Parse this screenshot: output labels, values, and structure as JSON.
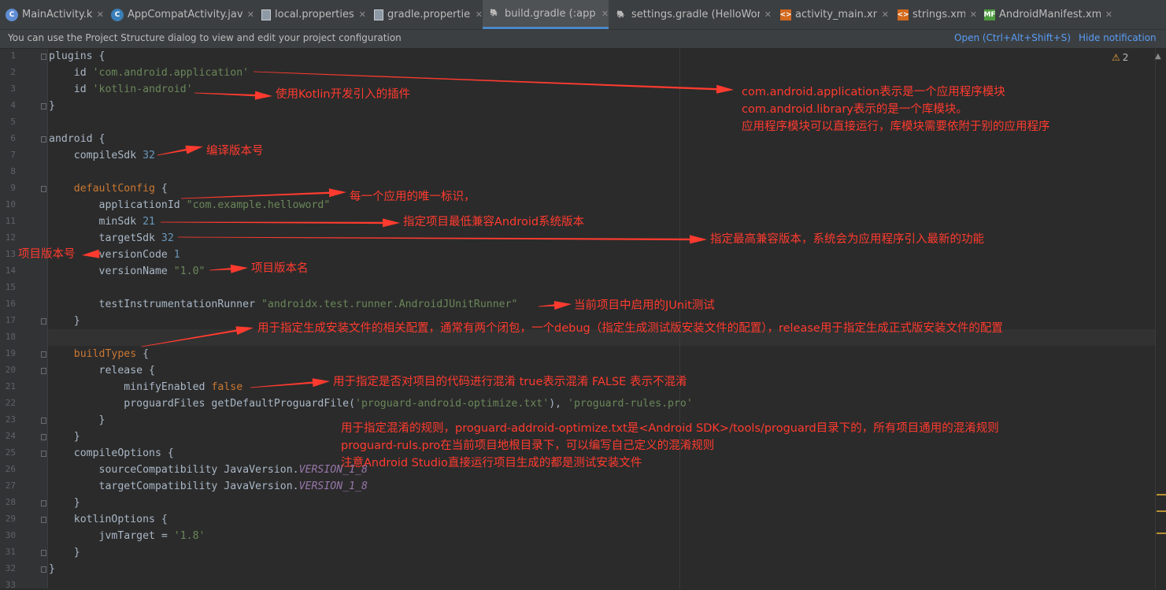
{
  "tabs": [
    {
      "label": "MainActivity.kt",
      "icon": "kotlin-class-icon",
      "active": false
    },
    {
      "label": "AppCompatActivity.java",
      "icon": "java-class-icon",
      "active": false
    },
    {
      "label": "local.properties",
      "icon": "properties-file-icon",
      "active": false
    },
    {
      "label": "gradle.properties",
      "icon": "properties-file-icon",
      "active": false
    },
    {
      "label": "build.gradle (:app)",
      "icon": "gradle-elephant-icon",
      "active": true
    },
    {
      "label": "settings.gradle (HelloWord)",
      "icon": "gradle-elephant-icon",
      "active": false
    },
    {
      "label": "activity_main.xml",
      "icon": "xml-file-icon",
      "active": false
    },
    {
      "label": "strings.xml",
      "icon": "xml-file-icon",
      "active": false
    },
    {
      "label": "AndroidManifest.xml",
      "icon": "manifest-file-icon",
      "active": false
    }
  ],
  "notification": {
    "message": "You can use the Project Structure dialog to view and edit your project configuration",
    "open_link": "Open (Ctrl+Alt+Shift+S)",
    "hide_link": "Hide notification"
  },
  "inspection": {
    "warning_count": "2",
    "icon": "warning-triangle-icon"
  },
  "line_numbers": [
    "1",
    "2",
    "3",
    "4",
    "5",
    "6",
    "7",
    "8",
    "9",
    "10",
    "11",
    "12",
    "13",
    "14",
    "15",
    "16",
    "17",
    "18",
    "19",
    "20",
    "21",
    "22",
    "23",
    "24",
    "25",
    "26",
    "27",
    "28",
    "29",
    "30",
    "31",
    "32",
    "33"
  ],
  "current_line": 18,
  "code": [
    {
      "line": 1,
      "tokens": [
        {
          "t": "plugins {",
          "k": "p"
        }
      ]
    },
    {
      "line": 2,
      "tokens": [
        {
          "t": "    id ",
          "k": "p"
        },
        {
          "t": "'com.android.application'",
          "k": "s"
        }
      ]
    },
    {
      "line": 3,
      "tokens": [
        {
          "t": "    id ",
          "k": "p"
        },
        {
          "t": "'kotlin-android'",
          "k": "s"
        }
      ]
    },
    {
      "line": 4,
      "tokens": [
        {
          "t": "}",
          "k": "p"
        }
      ]
    },
    {
      "line": 6,
      "tokens": [
        {
          "t": "android {",
          "k": "p"
        }
      ]
    },
    {
      "line": 7,
      "tokens": [
        {
          "t": "    compileSdk ",
          "k": "p"
        },
        {
          "t": "32",
          "k": "n"
        }
      ]
    },
    {
      "line": 9,
      "tokens": [
        {
          "t": "    ",
          "k": "p"
        },
        {
          "t": "defaultConfig",
          "k": "c2"
        },
        {
          "t": " {",
          "k": "p"
        }
      ]
    },
    {
      "line": 10,
      "tokens": [
        {
          "t": "        applicationId ",
          "k": "p"
        },
        {
          "t": "\"com.example.helloword\"",
          "k": "s"
        }
      ]
    },
    {
      "line": 11,
      "tokens": [
        {
          "t": "        minSdk ",
          "k": "p"
        },
        {
          "t": "21",
          "k": "n"
        }
      ]
    },
    {
      "line": 12,
      "tokens": [
        {
          "t": "        targetSdk ",
          "k": "p"
        },
        {
          "t": "32",
          "k": "n"
        }
      ]
    },
    {
      "line": 13,
      "tokens": [
        {
          "t": "        versionCode ",
          "k": "p"
        },
        {
          "t": "1",
          "k": "n"
        }
      ]
    },
    {
      "line": 14,
      "tokens": [
        {
          "t": "        versionName ",
          "k": "p"
        },
        {
          "t": "\"1.0\"",
          "k": "s"
        }
      ]
    },
    {
      "line": 16,
      "tokens": [
        {
          "t": "        testInstrumentationRunner ",
          "k": "p"
        },
        {
          "t": "\"androidx.test.runner.AndroidJUnitRunner\"",
          "k": "s"
        }
      ]
    },
    {
      "line": 17,
      "tokens": [
        {
          "t": "    }",
          "k": "p"
        }
      ]
    },
    {
      "line": 19,
      "tokens": [
        {
          "t": "    ",
          "k": "p"
        },
        {
          "t": "buildTypes",
          "k": "c2"
        },
        {
          "t": " {",
          "k": "p"
        }
      ]
    },
    {
      "line": 20,
      "tokens": [
        {
          "t": "        release {",
          "k": "p"
        }
      ]
    },
    {
      "line": 21,
      "tokens": [
        {
          "t": "            minifyEnabled ",
          "k": "p"
        },
        {
          "t": "false",
          "k": "b"
        }
      ]
    },
    {
      "line": 22,
      "tokens": [
        {
          "t": "            proguardFiles getDefaultProguardFile(",
          "k": "p"
        },
        {
          "t": "'proguard-android-optimize.txt'",
          "k": "s"
        },
        {
          "t": "), ",
          "k": "p"
        },
        {
          "t": "'proguard-rules.pro'",
          "k": "s"
        }
      ]
    },
    {
      "line": 23,
      "tokens": [
        {
          "t": "        }",
          "k": "p"
        }
      ]
    },
    {
      "line": 24,
      "tokens": [
        {
          "t": "    }",
          "k": "p"
        }
      ]
    },
    {
      "line": 25,
      "tokens": [
        {
          "t": "    compileOptions {",
          "k": "p"
        }
      ]
    },
    {
      "line": 26,
      "tokens": [
        {
          "t": "        sourceCompatibility JavaVersion.",
          "k": "p"
        },
        {
          "t": "VERSION_1_8",
          "k": "c"
        }
      ]
    },
    {
      "line": 27,
      "tokens": [
        {
          "t": "        targetCompatibility JavaVersion.",
          "k": "p"
        },
        {
          "t": "VERSION_1_8",
          "k": "c"
        }
      ]
    },
    {
      "line": 28,
      "tokens": [
        {
          "t": "    }",
          "k": "p"
        }
      ]
    },
    {
      "line": 29,
      "tokens": [
        {
          "t": "    kotlinOptions {",
          "k": "p"
        }
      ]
    },
    {
      "line": 30,
      "tokens": [
        {
          "t": "        jvmTarget = ",
          "k": "p"
        },
        {
          "t": "'1.8'",
          "k": "s"
        }
      ]
    },
    {
      "line": 31,
      "tokens": [
        {
          "t": "    }",
          "k": "p"
        }
      ]
    },
    {
      "line": 32,
      "tokens": [
        {
          "t": "}",
          "k": "p"
        }
      ]
    }
  ],
  "annotations": {
    "app_module_1": "com.android.application表示是一个应用程序模块",
    "app_module_2": "com.android.library表示的是一个库模块。",
    "app_module_3": "应用程序模块可以直接运行，库模块需要依附于别的应用程序",
    "kotlin_plugin": "使用Kotlin开发引入的插件",
    "compile_sdk": "编译版本号",
    "application_id": "每一个应用的唯一标识，",
    "min_sdk": "指定项目最低兼容Android系统版本",
    "target_sdk": "指定最高兼容版本，系统会为应用程序引入最新的功能",
    "version_code": "项目版本号",
    "version_name": "项目版本名",
    "junit": "当前项目中启用的JUnit测试",
    "build_types": "用于指定生成安装文件的相关配置，通常有两个闭包，一个debug（指定生成测试版安装文件的配置），release用于指定生成正式版安装文件的配置",
    "minify": "用于指定是否对项目的代码进行混淆 true表示混淆 FALSE 表示不混淆",
    "proguard_1": "用于指定混淆的规则，proguard-addroid-optimize.txt是<Android SDK>/tools/proguard目录下的，所有项目通用的混淆规则",
    "proguard_2": "proguard-ruls.pro在当前项目地根目录下，可以编写自己定义的混淆规则",
    "proguard_3": "注意Android Studio直接运行项目生成的都是测试安装文件"
  },
  "colors": {
    "annotation": "#ff3b2f",
    "string": "#6a8759",
    "number": "#6897bb",
    "keyword": "#cc7832",
    "constant": "#9876aa",
    "plain": "#a9b7c6"
  }
}
